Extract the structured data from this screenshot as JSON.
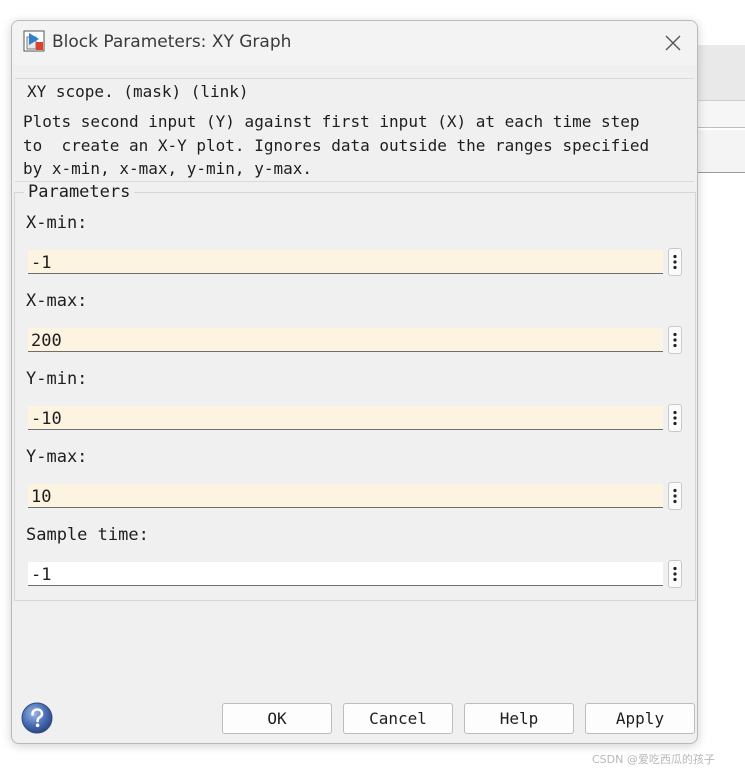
{
  "window": {
    "title": "Block Parameters: XY Graph"
  },
  "mask": {
    "heading": "XY scope. (mask) (link)",
    "description_lines": [
      "Plots second input (Y) against first input (X) at each time step",
      "to  create an X-Y plot. Ignores data outside the ranges specified",
      "by x-min, x-max, y-min, y-max."
    ]
  },
  "parameters": {
    "heading": "Parameters",
    "fields": [
      {
        "label": "X-min:",
        "value": "-1",
        "tinted": true
      },
      {
        "label": "X-max:",
        "value": "200",
        "tinted": true
      },
      {
        "label": "Y-min:",
        "value": "-10",
        "tinted": true
      },
      {
        "label": "Y-max:",
        "value": "10",
        "tinted": true
      },
      {
        "label": "Sample time:",
        "value": "-1",
        "tinted": false
      }
    ]
  },
  "buttons": {
    "ok": "OK",
    "cancel": "Cancel",
    "help": "Help",
    "apply": "Apply"
  },
  "icons": {
    "app": "simulink-block-icon",
    "close": "close-icon",
    "help": "help-icon",
    "more": "vertical-dots-icon"
  },
  "colors": {
    "dialog_bg": "#f0f0f0",
    "field_tint": "#fdf3e1",
    "help_blue": "#4a6fb5"
  },
  "watermark": "CSDN @爱吃西瓜的孩子"
}
